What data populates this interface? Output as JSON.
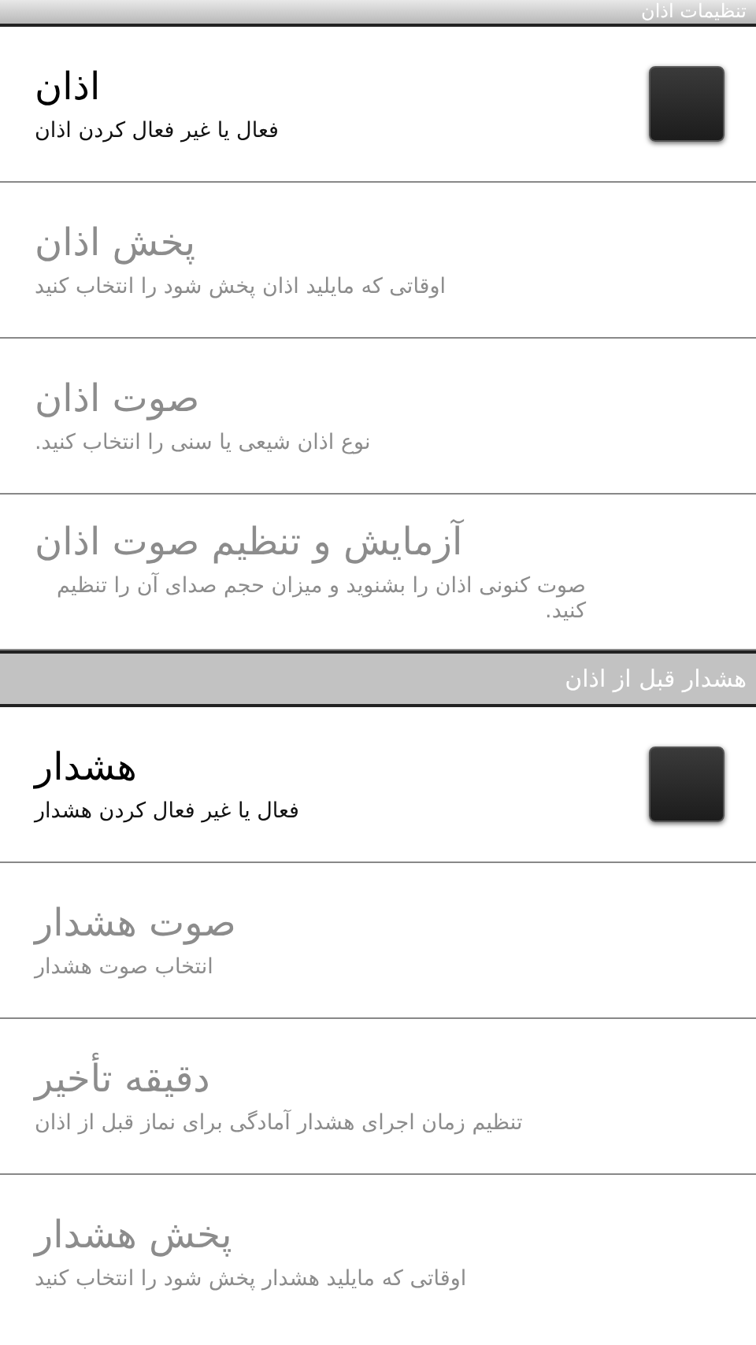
{
  "sections": [
    {
      "title": "تنظیمات اذان",
      "items": [
        {
          "kind": "checkbox",
          "title": "اذان",
          "summary": "فعال یا غیر فعال کردن اذان",
          "disabled": false,
          "checked": false
        },
        {
          "kind": "plain",
          "title": "پخش اذان",
          "summary": "اوقاتی که مایلید اذان پخش شود را انتخاب کنید",
          "disabled": true
        },
        {
          "kind": "plain",
          "title": "صوت اذان",
          "summary": "نوع اذان شیعی یا سنی را انتخاب کنید.",
          "disabled": true
        },
        {
          "kind": "plain",
          "title": "آزمایش و تنظیم صوت اذان",
          "summary": "صوت کنونی اذان را بشنوید و میزان حجم صدای آن را تنظیم کنید.",
          "disabled": true
        }
      ]
    },
    {
      "title": "هشدار قبل از اذان",
      "items": [
        {
          "kind": "checkbox",
          "title": "هشدار",
          "summary": "فعال یا غیر فعال کردن هشدار",
          "disabled": false,
          "checked": false
        },
        {
          "kind": "plain",
          "title": "صوت هشدار",
          "summary": "انتخاب صوت هشدار",
          "disabled": true
        },
        {
          "kind": "plain",
          "title": "دقیقه تأخیر",
          "summary": "تنظیم زمان اجرای هشدار آمادگی برای نماز قبل از اذان",
          "disabled": true
        },
        {
          "kind": "plain",
          "title": "پخش هشدار",
          "summary": "اوقاتی که مایلید هشدار پخش شود را انتخاب کنید",
          "disabled": true
        }
      ]
    }
  ]
}
